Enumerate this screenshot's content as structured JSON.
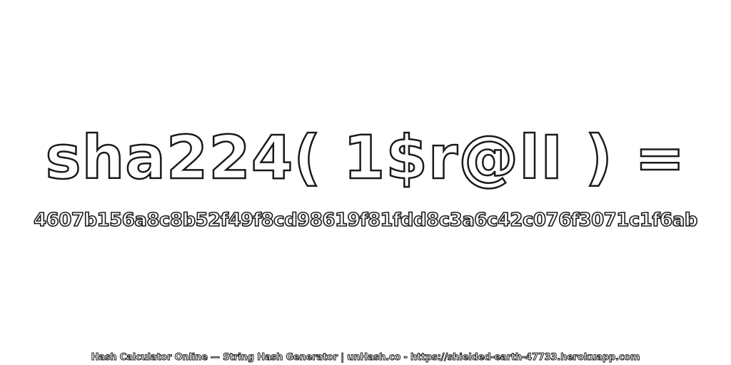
{
  "expression": "sha224( 1$r@lI ) =",
  "hash_value": "4607b156a8c8b52f49f8cd98619f81fdd8c3a6c42c076f3071c1f6ab",
  "footer": "Hash Calculator Online — String Hash Generator | unHash.co - https://shielded-earth-47733.herokuapp.com"
}
